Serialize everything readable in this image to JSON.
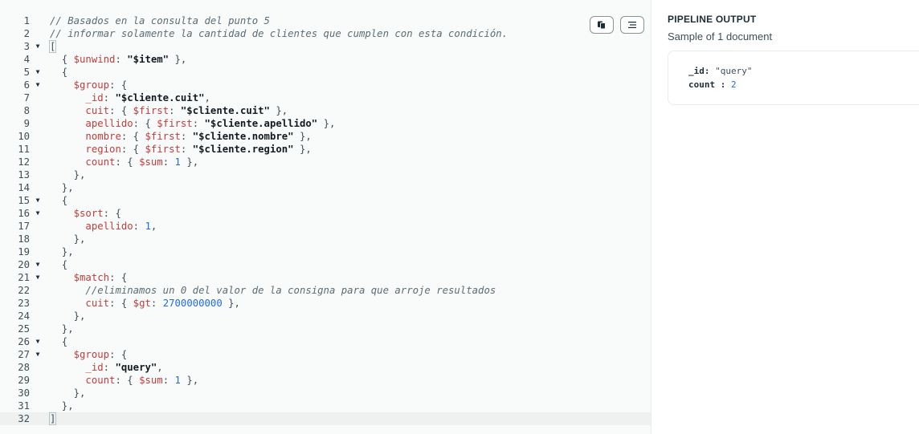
{
  "editor": {
    "active_line": 32,
    "lines": [
      {
        "n": "1",
        "fold": "",
        "tokens": [
          [
            "cm",
            "// Basados en la consulta del punto 5"
          ]
        ]
      },
      {
        "n": "2",
        "fold": "",
        "tokens": [
          [
            "cm",
            "// informar solamente la cantidad de clientes que cumplen con esta condición."
          ]
        ]
      },
      {
        "n": "3",
        "fold": "▼",
        "tokens": [
          [
            "brk",
            "["
          ]
        ]
      },
      {
        "n": "4",
        "fold": "",
        "tokens": [
          [
            "pun",
            "  { "
          ],
          [
            "key",
            "$unwind"
          ],
          [
            "pun",
            ": "
          ],
          [
            "str",
            "\"$item\""
          ],
          [
            "pun",
            " },"
          ]
        ]
      },
      {
        "n": "5",
        "fold": "▼",
        "tokens": [
          [
            "pun",
            "  {"
          ]
        ]
      },
      {
        "n": "6",
        "fold": "▼",
        "tokens": [
          [
            "pun",
            "    "
          ],
          [
            "key",
            "$group"
          ],
          [
            "pun",
            ": {"
          ]
        ]
      },
      {
        "n": "7",
        "fold": "",
        "tokens": [
          [
            "pun",
            "      "
          ],
          [
            "key",
            "_id"
          ],
          [
            "pun",
            ": "
          ],
          [
            "str",
            "\"$cliente.cuit\""
          ],
          [
            "pun",
            ","
          ]
        ]
      },
      {
        "n": "8",
        "fold": "",
        "tokens": [
          [
            "pun",
            "      "
          ],
          [
            "key",
            "cuit"
          ],
          [
            "pun",
            ": { "
          ],
          [
            "key",
            "$first"
          ],
          [
            "pun",
            ": "
          ],
          [
            "str",
            "\"$cliente.cuit\""
          ],
          [
            "pun",
            " },"
          ]
        ]
      },
      {
        "n": "9",
        "fold": "",
        "tokens": [
          [
            "pun",
            "      "
          ],
          [
            "key",
            "apellido"
          ],
          [
            "pun",
            ": { "
          ],
          [
            "key",
            "$first"
          ],
          [
            "pun",
            ": "
          ],
          [
            "str",
            "\"$cliente.apellido\""
          ],
          [
            "pun",
            " },"
          ]
        ]
      },
      {
        "n": "10",
        "fold": "",
        "tokens": [
          [
            "pun",
            "      "
          ],
          [
            "key",
            "nombre"
          ],
          [
            "pun",
            ": { "
          ],
          [
            "key",
            "$first"
          ],
          [
            "pun",
            ": "
          ],
          [
            "str",
            "\"$cliente.nombre\""
          ],
          [
            "pun",
            " },"
          ]
        ]
      },
      {
        "n": "11",
        "fold": "",
        "tokens": [
          [
            "pun",
            "      "
          ],
          [
            "key",
            "region"
          ],
          [
            "pun",
            ": { "
          ],
          [
            "key",
            "$first"
          ],
          [
            "pun",
            ": "
          ],
          [
            "str",
            "\"$cliente.region\""
          ],
          [
            "pun",
            " },"
          ]
        ]
      },
      {
        "n": "12",
        "fold": "",
        "tokens": [
          [
            "pun",
            "      "
          ],
          [
            "key",
            "count"
          ],
          [
            "pun",
            ": { "
          ],
          [
            "key",
            "$sum"
          ],
          [
            "pun",
            ": "
          ],
          [
            "num",
            "1"
          ],
          [
            "pun",
            " },"
          ]
        ]
      },
      {
        "n": "13",
        "fold": "",
        "tokens": [
          [
            "pun",
            "    },"
          ]
        ]
      },
      {
        "n": "14",
        "fold": "",
        "tokens": [
          [
            "pun",
            "  },"
          ]
        ]
      },
      {
        "n": "15",
        "fold": "▼",
        "tokens": [
          [
            "pun",
            "  {"
          ]
        ]
      },
      {
        "n": "16",
        "fold": "▼",
        "tokens": [
          [
            "pun",
            "    "
          ],
          [
            "key",
            "$sort"
          ],
          [
            "pun",
            ": {"
          ]
        ]
      },
      {
        "n": "17",
        "fold": "",
        "tokens": [
          [
            "pun",
            "      "
          ],
          [
            "key",
            "apellido"
          ],
          [
            "pun",
            ": "
          ],
          [
            "num",
            "1"
          ],
          [
            "pun",
            ","
          ]
        ]
      },
      {
        "n": "18",
        "fold": "",
        "tokens": [
          [
            "pun",
            "    },"
          ]
        ]
      },
      {
        "n": "19",
        "fold": "",
        "tokens": [
          [
            "pun",
            "  },"
          ]
        ]
      },
      {
        "n": "20",
        "fold": "▼",
        "tokens": [
          [
            "pun",
            "  {"
          ]
        ]
      },
      {
        "n": "21",
        "fold": "▼",
        "tokens": [
          [
            "pun",
            "    "
          ],
          [
            "key",
            "$match"
          ],
          [
            "pun",
            ": {"
          ]
        ]
      },
      {
        "n": "22",
        "fold": "",
        "tokens": [
          [
            "pun",
            "      "
          ],
          [
            "cm",
            "//eliminamos un 0 del valor de la consigna para que arroje resultados"
          ]
        ]
      },
      {
        "n": "23",
        "fold": "",
        "tokens": [
          [
            "pun",
            "      "
          ],
          [
            "key",
            "cuit"
          ],
          [
            "pun",
            ": { "
          ],
          [
            "key",
            "$gt"
          ],
          [
            "pun",
            ": "
          ],
          [
            "num",
            "2700000000"
          ],
          [
            "pun",
            " },"
          ]
        ]
      },
      {
        "n": "24",
        "fold": "",
        "tokens": [
          [
            "pun",
            "    },"
          ]
        ]
      },
      {
        "n": "25",
        "fold": "",
        "tokens": [
          [
            "pun",
            "  },"
          ]
        ]
      },
      {
        "n": "26",
        "fold": "▼",
        "tokens": [
          [
            "pun",
            "  {"
          ]
        ]
      },
      {
        "n": "27",
        "fold": "▼",
        "tokens": [
          [
            "pun",
            "    "
          ],
          [
            "key",
            "$group"
          ],
          [
            "pun",
            ": {"
          ]
        ]
      },
      {
        "n": "28",
        "fold": "",
        "tokens": [
          [
            "pun",
            "      "
          ],
          [
            "key",
            "_id"
          ],
          [
            "pun",
            ": "
          ],
          [
            "str",
            "\"query\""
          ],
          [
            "pun",
            ","
          ]
        ]
      },
      {
        "n": "29",
        "fold": "",
        "tokens": [
          [
            "pun",
            "      "
          ],
          [
            "key",
            "count"
          ],
          [
            "pun",
            ": { "
          ],
          [
            "key",
            "$sum"
          ],
          [
            "pun",
            ": "
          ],
          [
            "num",
            "1"
          ],
          [
            "pun",
            " },"
          ]
        ]
      },
      {
        "n": "30",
        "fold": "",
        "tokens": [
          [
            "pun",
            "    },"
          ]
        ]
      },
      {
        "n": "31",
        "fold": "",
        "tokens": [
          [
            "pun",
            "  },"
          ]
        ]
      },
      {
        "n": "32",
        "fold": "",
        "tokens": [
          [
            "brk",
            "]"
          ]
        ]
      }
    ],
    "toolbar": {
      "copy_icon": "copy-icon",
      "format_icon": "format-lines-icon"
    }
  },
  "output": {
    "title": "PIPELINE OUTPUT",
    "subtitle": "Sample of 1 document",
    "document": {
      "id_key": "_id",
      "id_sep": ": ",
      "id_value": "\"query\"",
      "count_key": "count",
      "count_sep": " : ",
      "count_value": "2"
    }
  },
  "colors": {
    "key": "#c23b3b",
    "string": "#111a22",
    "number": "#1e6be6",
    "comment": "#5c6c75"
  }
}
